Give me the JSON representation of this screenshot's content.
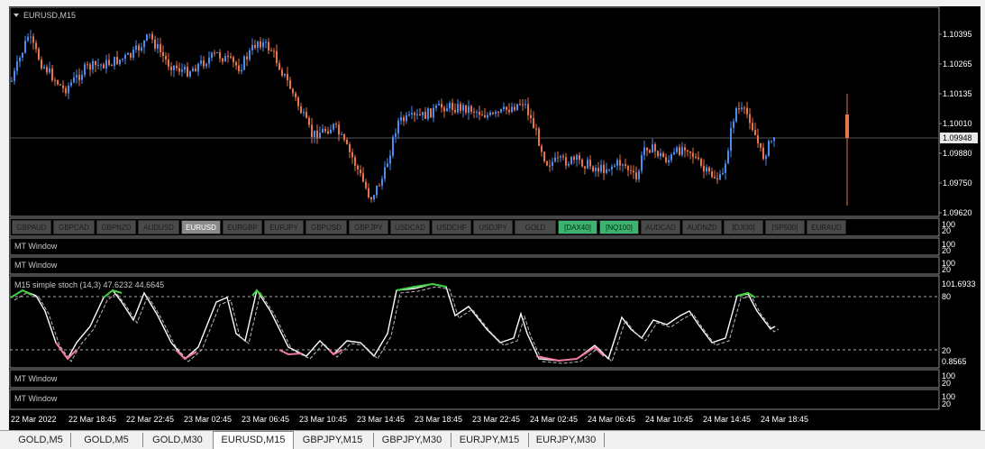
{
  "chart": {
    "title": "EURUSD,M15",
    "price_ticks": [
      "1.10395",
      "1.10265",
      "1.10135",
      "1.10010",
      "1.09880",
      "1.09750",
      "1.09620"
    ],
    "current_price": "1.09948",
    "symbol_buttons": [
      {
        "label": "GBPAUD",
        "state": "normal"
      },
      {
        "label": "GBPCAD",
        "state": "normal"
      },
      {
        "label": "GBPNZD",
        "state": "normal"
      },
      {
        "label": "AUDUSD",
        "state": "normal"
      },
      {
        "label": "EURUSD",
        "state": "active"
      },
      {
        "label": "EURGBP",
        "state": "normal"
      },
      {
        "label": "EURJPY",
        "state": "normal"
      },
      {
        "label": "GBPUSD",
        "state": "normal"
      },
      {
        "label": "GBPJPY",
        "state": "normal"
      },
      {
        "label": "USDCAD",
        "state": "normal"
      },
      {
        "label": "USDCHF",
        "state": "normal"
      },
      {
        "label": "USDJPY",
        "state": "normal"
      },
      {
        "label": "GOLD",
        "state": "normal"
      },
      {
        "label": "[DAX40]",
        "state": "green"
      },
      {
        "label": "[NQ100]",
        "state": "green"
      },
      {
        "label": "AUDCAD",
        "state": "normal"
      },
      {
        "label": "AUDNZD",
        "state": "normal"
      },
      {
        "label": "[DJI30]",
        "state": "normal"
      },
      {
        "label": "[SP500]",
        "state": "normal"
      },
      {
        "label": "EURAUD",
        "state": "normal"
      }
    ],
    "button_panel_scale": {
      "top": "100",
      "bottom": "20"
    }
  },
  "windows": [
    {
      "label": "MT Window",
      "scale_top": "100",
      "scale_bottom": "20"
    },
    {
      "label": "MT Window",
      "scale_top": "100",
      "scale_bottom": "20"
    }
  ],
  "stoch": {
    "title": "M15  simple stoch (14,3) 47.6232 44.6645",
    "scale": [
      "101.6933",
      "80",
      "20",
      "0.8565"
    ]
  },
  "bottom_windows": [
    {
      "label": "MT Window",
      "scale_top": "100",
      "scale_bottom": "20"
    },
    {
      "label": "MT Window",
      "scale_top": "100",
      "scale_bottom": "20"
    }
  ],
  "time_axis": [
    "22 Mar 2022",
    "22 Mar 18:45",
    "22 Mar 22:45",
    "23 Mar 02:45",
    "23 Mar 06:45",
    "23 Mar 10:45",
    "23 Mar 14:45",
    "23 Mar 18:45",
    "23 Mar 22:45",
    "24 Mar 02:45",
    "24 Mar 06:45",
    "24 Mar 10:45",
    "24 Mar 14:45",
    "24 Mar 18:45"
  ],
  "tabs": [
    {
      "label": "GOLD,M5",
      "active": false
    },
    {
      "label": "GOLD,M5",
      "active": false
    },
    {
      "label": "GOLD,M30",
      "active": false
    },
    {
      "label": "EURUSD,M15",
      "active": true
    },
    {
      "label": "GBPJPY,M15",
      "active": false
    },
    {
      "label": "GBPJPY,M30",
      "active": false
    },
    {
      "label": "EURJPY,M15",
      "active": false
    },
    {
      "label": "EURJPY,M30",
      "active": false
    }
  ]
}
